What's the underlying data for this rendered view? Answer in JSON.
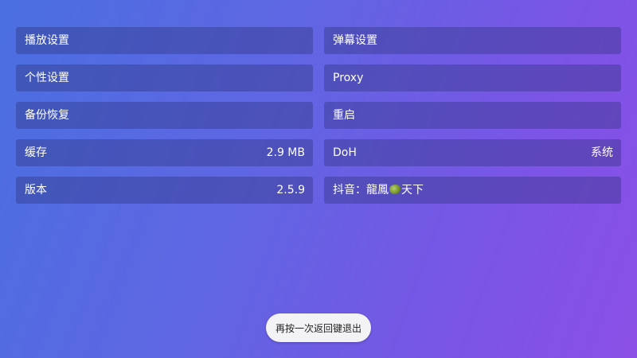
{
  "settings": {
    "items": [
      {
        "label": "播放设置",
        "value": ""
      },
      {
        "label": "弹幕设置",
        "value": ""
      },
      {
        "label": "个性设置",
        "value": ""
      },
      {
        "label": "Proxy",
        "value": ""
      },
      {
        "label": "备份恢复",
        "value": ""
      },
      {
        "label": "重启",
        "value": ""
      },
      {
        "label": "缓存",
        "value": "2.9 MB"
      },
      {
        "label": "DoH",
        "value": "系统"
      },
      {
        "label": "版本",
        "value": "2.5.9"
      },
      {
        "label_prefix": "抖音：龍鳳",
        "label_suffix": "天下",
        "value": ""
      }
    ]
  },
  "toast": {
    "text": "再按一次返回键退出"
  }
}
